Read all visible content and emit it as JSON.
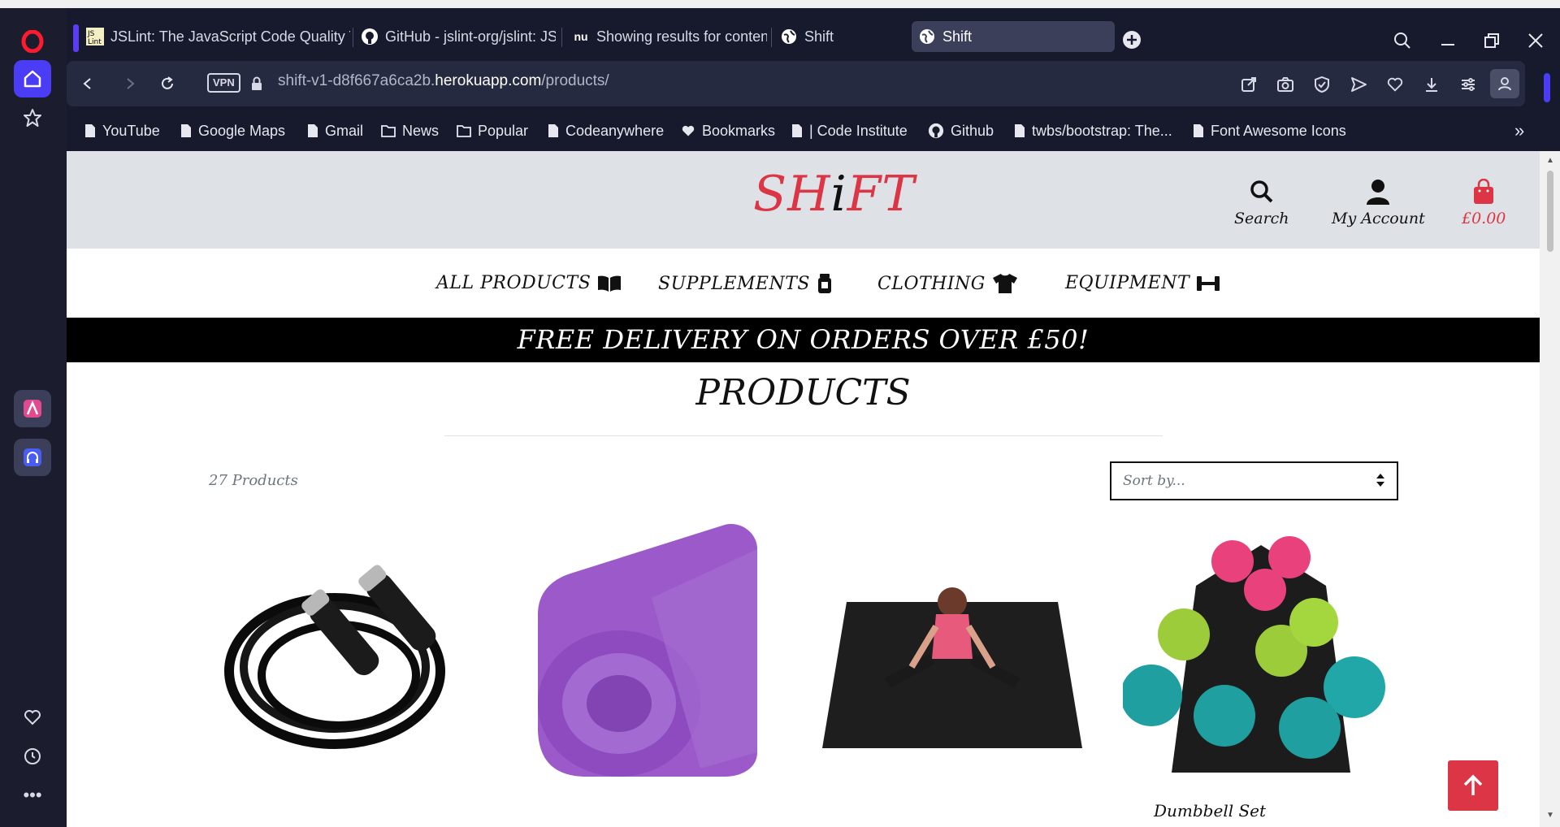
{
  "browser": {
    "tabs": [
      {
        "label": "JSLint: The JavaScript Code Quality Tool",
        "icon": "jslint-favicon"
      },
      {
        "label": "GitHub - jslint-org/jslint: JSLint",
        "icon": "github-favicon"
      },
      {
        "label": "Showing results for contents",
        "icon": "nu-favicon"
      },
      {
        "label": "Shift",
        "icon": "globe-icon"
      },
      {
        "label": "Shift",
        "icon": "globe-icon",
        "active": true
      }
    ],
    "vpn_label": "VPN",
    "url_prefix": "shift-v1-d8f667a6ca2b.",
    "url_host": "herokuapp.com",
    "url_path": "/products/",
    "bookmarks": [
      {
        "label": "YouTube",
        "icon": "page-icon"
      },
      {
        "label": "Google Maps",
        "icon": "page-icon"
      },
      {
        "label": "Gmail",
        "icon": "page-icon"
      },
      {
        "label": "News",
        "icon": "folder-icon"
      },
      {
        "label": "Popular",
        "icon": "folder-icon"
      },
      {
        "label": "Codeanywhere",
        "icon": "page-icon"
      },
      {
        "label": "Bookmarks",
        "icon": "heart-icon"
      },
      {
        "label": "| Code Institute",
        "icon": "page-icon"
      },
      {
        "label": "Github",
        "icon": "github-icon"
      },
      {
        "label": "twbs/bootstrap: The...",
        "icon": "page-icon"
      },
      {
        "label": "Font Awesome Icons",
        "icon": "page-icon"
      }
    ],
    "more_bookmarks": "»"
  },
  "site": {
    "logo_part1": "SH",
    "logo_part2": "i",
    "logo_part3": "FT",
    "header_links": {
      "search": "Search",
      "account": "My Account",
      "cart": "£0.00"
    },
    "nav": [
      {
        "label": "ALL PRODUCTS",
        "icon": "book-open-icon"
      },
      {
        "label": "SUPPLEMENTS",
        "icon": "jar-icon"
      },
      {
        "label": "CLOTHING",
        "icon": "tshirt-icon"
      },
      {
        "label": "EQUIPMENT",
        "icon": "dumbbell-icon"
      }
    ],
    "banner": "FREE DELIVERY ON ORDERS OVER £50!",
    "page_title": "PRODUCTS",
    "product_count": "27 Products",
    "sort_placeholder": "Sort by...",
    "products": [
      {
        "name": "",
        "image": "skipping-rope"
      },
      {
        "name": "",
        "image": "purple-yoga-mat"
      },
      {
        "name": "",
        "image": "exercise-mat"
      },
      {
        "name": "Dumbbell Set",
        "image": "dumbbell-set"
      }
    ]
  },
  "colors": {
    "brand_red": "#dc3545",
    "header_grey": "#dee2e6",
    "browser_dark": "#171a2c"
  }
}
